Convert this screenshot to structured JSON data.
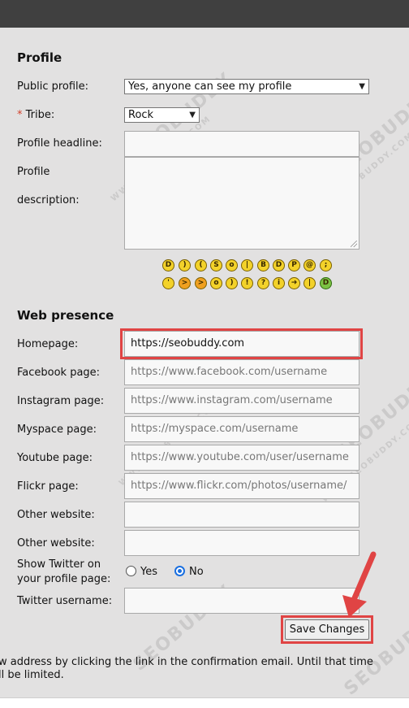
{
  "profile": {
    "title": "Profile",
    "public_profile_label": "Public profile:",
    "public_profile_value": "Yes, anyone can see my profile",
    "tribe_required_mark": "*",
    "tribe_label": "Tribe:",
    "tribe_value": "Rock",
    "headline_label": "Profile headline:",
    "description_label_1": "Profile",
    "description_label_2": "description:"
  },
  "web_presence": {
    "title": "Web presence",
    "homepage_label": "Homepage:",
    "homepage_value": "https://seobuddy.com",
    "facebook_label": "Facebook page:",
    "facebook_placeholder": "https://www.facebook.com/username",
    "instagram_label": "Instagram page:",
    "instagram_placeholder": "https://www.instagram.com/username",
    "myspace_label": "Myspace page:",
    "myspace_placeholder": "https://myspace.com/username",
    "youtube_label": "Youtube page:",
    "youtube_placeholder": "https://www.youtube.com/user/username",
    "flickr_label": "Flickr page:",
    "flickr_placeholder": "https://www.flickr.com/photos/username/",
    "other_website_label_1": "Other website:",
    "other_website_label_2": "Other website:",
    "show_twitter_label_1": "Show Twitter on",
    "show_twitter_label_2": "your profile page:",
    "radio_yes": "Yes",
    "radio_no": "No",
    "twitter_username_label": "Twitter username:"
  },
  "save_button": "Save Changes",
  "footer_line_1": "w address by clicking the link in the confirmation email. Until that time",
  "footer_line_2": "ll be limited.",
  "watermark_text": "SEOBUDDY",
  "watermark_sub": "WWW.SEOBUDDY.COM",
  "colors": {
    "topbar": "#404040",
    "highlight": "#e04444",
    "radio_accent": "#1a6fe0",
    "background": "#e2e1e1"
  },
  "smileys_row1": [
    "grin-icon",
    "smile-icon",
    "sad-icon",
    "confused-icon",
    "surprised-icon",
    "neutral-icon",
    "cool-icon",
    "laugh-icon",
    "razz-icon",
    "mad-icon",
    "wink-icon"
  ],
  "smileys_row2": [
    "cry-icon",
    "evil-icon",
    "twisted-icon",
    "rolleyes-icon",
    "smile-alt-icon",
    "exclaim-icon",
    "question-icon",
    "idea-icon",
    "arrow-icon",
    "neutral-alt-icon",
    "mrgreen-icon"
  ]
}
